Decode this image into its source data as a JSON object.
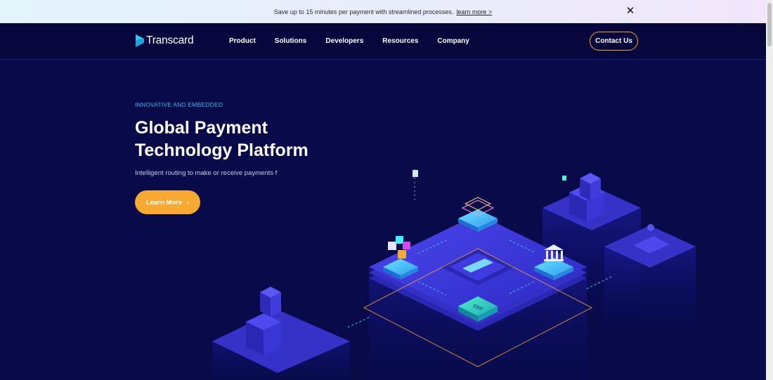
{
  "announcement": {
    "text": "Save up to 15 minutes per payment with streamlined processes.",
    "link": "learn more >",
    "close_glyph": "✕"
  },
  "nav": {
    "logo": "Transcard",
    "items": [
      {
        "label": "Product"
      },
      {
        "label": "Solutions"
      },
      {
        "label": "Developers"
      },
      {
        "label": "Resources"
      },
      {
        "label": "Company"
      }
    ],
    "contact": "Contact Us"
  },
  "hero": {
    "eyebrow": "INNOVATIVE AND EMBEDDED",
    "title_line1": "Global Payment",
    "title_line2": "Technology Platform",
    "subtitle": "Intelligent routing to make or receive payments f",
    "cta": "Learn More",
    "cta_glyph": "›",
    "erp_label": "ERP"
  },
  "colors": {
    "background": "#080a4a",
    "accent_orange": "#f7a932",
    "eyebrow_blue": "#3fb3e6",
    "platform_blue": "#3a36d6"
  },
  "icons": [
    "close-icon",
    "transcard-logo-icon",
    "chevron-right-icon",
    "erp-tile-icon",
    "bank-icon",
    "cubes-icon",
    "building-icon"
  ]
}
